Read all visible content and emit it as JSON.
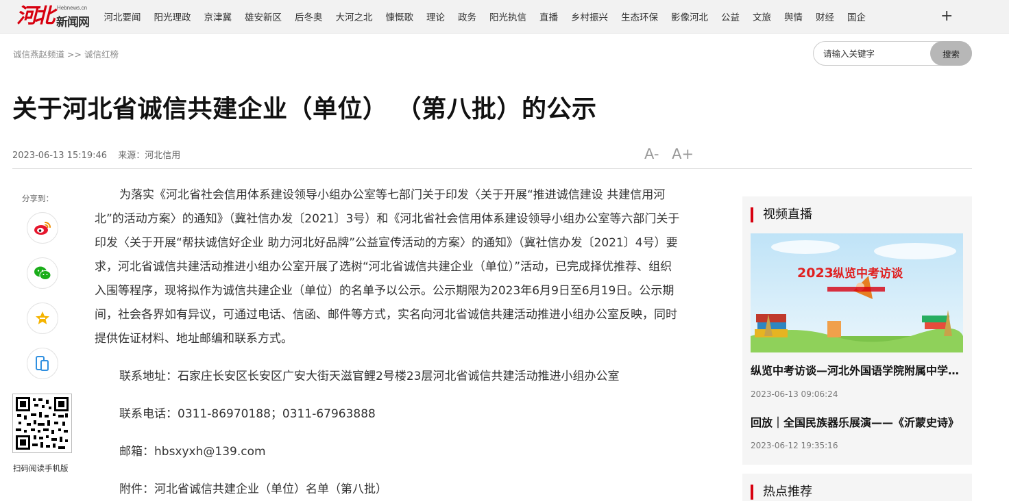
{
  "logo": {
    "mark": "河北",
    "en": "Hebnews.cn",
    "cn": "新闻网"
  },
  "nav": [
    "河北要闻",
    "阳光理政",
    "京津冀",
    "雄安新区",
    "后冬奥",
    "大河之北",
    "慷慨歌",
    "理论",
    "政务",
    "阳光执信",
    "直播",
    "乡村振兴",
    "生态环保",
    "影像河北",
    "公益",
    "文旅",
    "舆情",
    "财经",
    "国企"
  ],
  "nav_more": "+",
  "breadcrumb": {
    "parent": "诚信燕赵频道",
    "sep": ">>",
    "current": "诚信红榜"
  },
  "search": {
    "placeholder": "请输入关键字",
    "button": "搜索"
  },
  "article": {
    "title": "关于河北省诚信共建企业（单位）  （第八批）的公示",
    "datetime": "2023-06-13 15:19:46",
    "source": "来源：河北信用",
    "font_smaller": "A-",
    "font_larger": "A+",
    "body": "为落实《河北省社会信用体系建设领导小组办公室等七部门关于印发〈关于开展“推进诚信建设 共建信用河北”的活动方案〉的通知》（冀社信办发〔2021〕3号）和《河北省社会信用体系建设领导小组办公室等六部门关于印发〈关于开展“帮扶诚信好企业 助力河北好品牌”公益宣传活动的方案〉的通知》（冀社信办发〔2021〕4号）要求，河北省诚信共建活动推进小组办公室开展了选树“河北省诚信共建企业（单位）”活动，已完成择优推荐、组织入围等程序，现将拟作为诚信共建企业（单位）的名单予以公示。公示期限为2023年6月9日至6月19日。公示期间，社会各界如有异议，可通过电话、信函、邮件等方式，实名向河北省诚信共建活动推进小组办公室反映，同时提供佐证材料、地址邮编和联系方式。",
    "address": "联系地址：石家庄长安区长安区广安大街天滋官鲤2号楼23层河北省诚信共建活动推进小组办公室",
    "phone": "联系电话：0311-86970188；0311-67963888",
    "email": "邮箱：hbsxyxh@139.com",
    "attachment": "附件：河北省诚信共建企业（单位）名单（第八批）"
  },
  "share": {
    "label": "分享到：",
    "qr_caption": "扫码阅读手机版"
  },
  "sidebar": {
    "video_heading": "视频直播",
    "video_banner_year": "2023",
    "video_banner_text": "纵览中考访谈",
    "items": [
      {
        "title": "纵览中考访谈—河北外国语学院附属中学…",
        "date": "2023-06-13 09:06:24"
      },
      {
        "title": "回放｜全国民族器乐展演——《沂蒙史诗》",
        "date": "2023-06-12 19:35:16"
      }
    ],
    "hot_heading": "热点推荐"
  },
  "colors": {
    "brand_red": "#d7000f",
    "weibo": "#e6162d",
    "wechat": "#1aad19",
    "favorite": "#f5b400",
    "mobile": "#2f8fe0"
  },
  "icons": [
    "weibo-icon",
    "wechat-icon",
    "favorite-icon",
    "mobile-icon",
    "qr-code-icon",
    "plus-icon"
  ]
}
